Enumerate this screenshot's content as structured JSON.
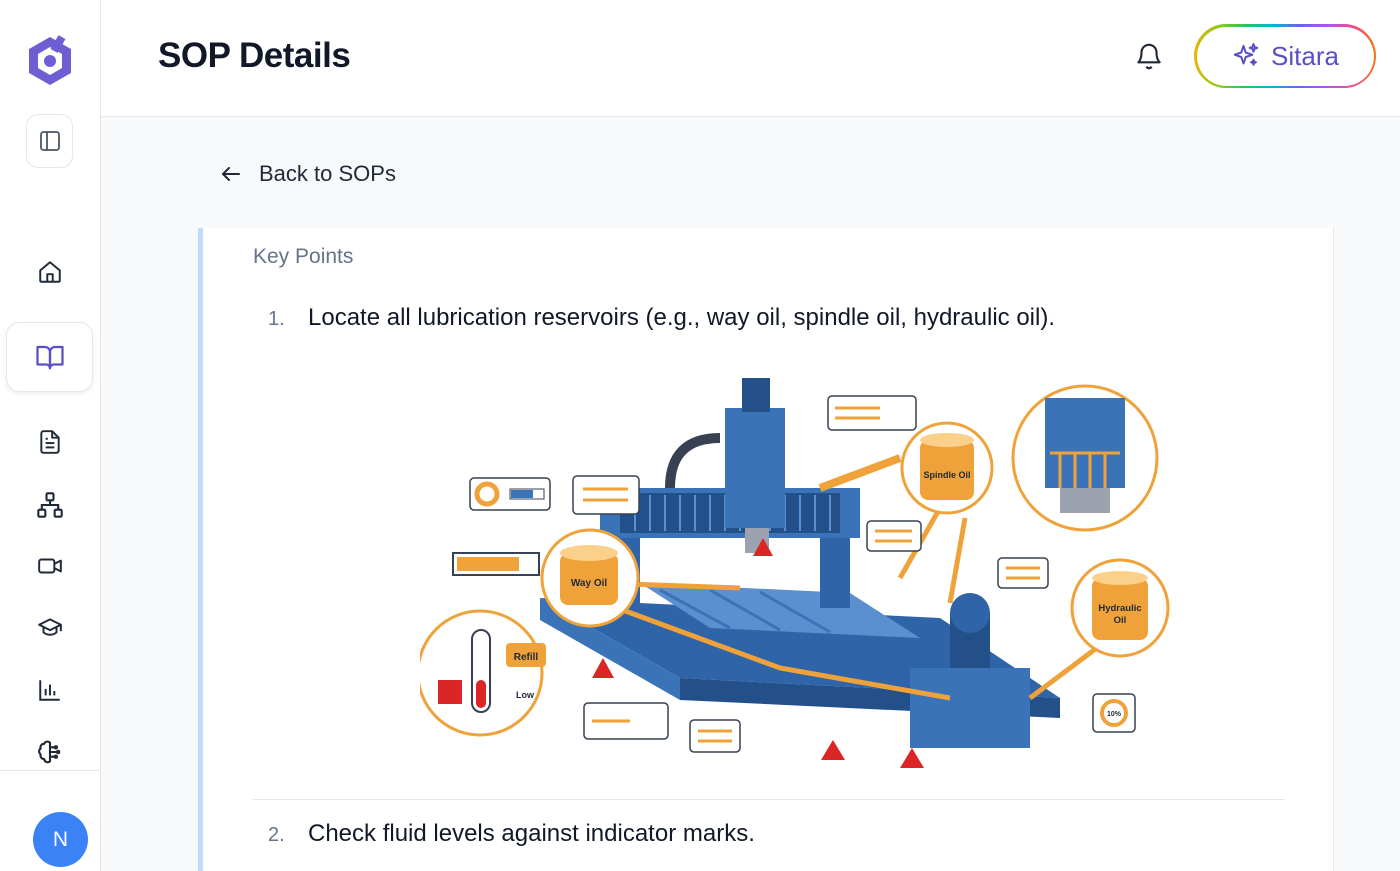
{
  "app": {
    "user_initial": "N"
  },
  "header": {
    "title": "SOP Details",
    "assistant_label": "Sitara"
  },
  "sidebar": {
    "items": [
      {
        "name": "home",
        "icon": "home-icon"
      },
      {
        "name": "sops",
        "icon": "book-open-icon",
        "active": true
      },
      {
        "name": "documents",
        "icon": "file-text-icon"
      },
      {
        "name": "org-chart",
        "icon": "network-icon"
      },
      {
        "name": "videos",
        "icon": "video-icon"
      },
      {
        "name": "training",
        "icon": "graduation-cap-icon"
      },
      {
        "name": "analytics",
        "icon": "bar-chart-icon"
      },
      {
        "name": "ai",
        "icon": "brain-icon"
      }
    ]
  },
  "nav": {
    "back_label": "Back to SOPs"
  },
  "content": {
    "section_label": "Key Points",
    "points": [
      {
        "number": "1.",
        "text": "Locate all lubrication reservoirs (e.g., way oil, spindle oil, hydraulic oil)."
      },
      {
        "number": "2.",
        "text": "Check fluid levels against indicator marks."
      }
    ],
    "figure_labels": {
      "way_oil": "Way Oil",
      "spindle_oil": "Spindle Oil",
      "hydraulic_oil_1": "Hydraulic",
      "hydraulic_oil_2": "Oil",
      "refill": "Refill",
      "low": "Low",
      "percent": "10%"
    }
  },
  "colors": {
    "accent": "#5b4fc6",
    "avatar": "#3b82f6",
    "machine_blue": "#3b73b9",
    "oil_orange": "#f0a23a",
    "warning_red": "#dc2626"
  }
}
